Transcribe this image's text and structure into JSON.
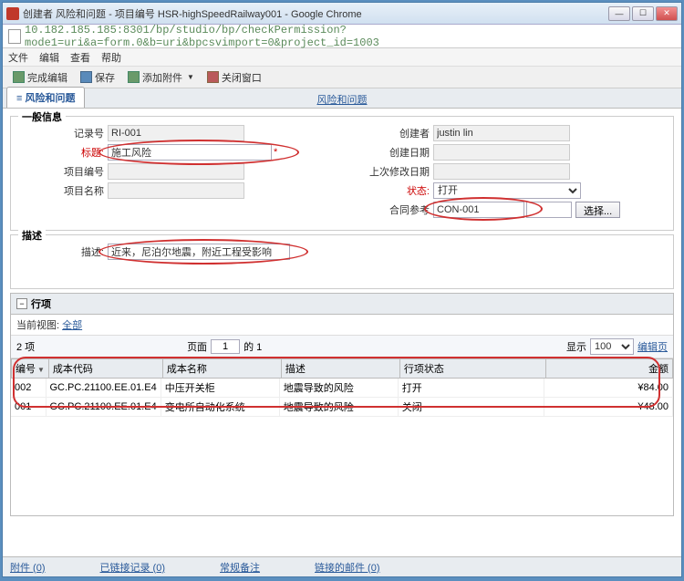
{
  "window": {
    "title": "创建者 风险和问题 - 项目编号 HSR-highSpeedRailway001 - Google Chrome",
    "url": "10.182.185.185:8301/bp/studio/bp/checkPermission?mode1=uri&a=form.0&b=uri&bpcsvimport=0&project_id=1003"
  },
  "menu": {
    "file": "文件",
    "edit": "编辑",
    "view": "查看",
    "help": "帮助"
  },
  "toolbar": {
    "finish": "完成编辑",
    "save": "保存",
    "attach": "添加附件",
    "close": "关闭窗口"
  },
  "tabs": {
    "main": "风险和问题",
    "center": "风险和问题"
  },
  "general": {
    "legend": "一般信息",
    "record_no_lbl": "记录号",
    "record_no": "RI-001",
    "title_lbl": "标题:",
    "title_val": "施工风险",
    "proj_no_lbl": "项目编号",
    "proj_no": "",
    "proj_name_lbl": "项目名称",
    "proj_name": "",
    "creator_lbl": "创建者",
    "creator": "justin lin",
    "create_date_lbl": "创建日期",
    "create_date": "",
    "mod_date_lbl": "上次修改日期",
    "mod_date": "",
    "status_lbl": "状态:",
    "status": "打开",
    "contract_lbl": "合同参考",
    "contract": "CON-001",
    "select_btn": "选择..."
  },
  "desc": {
    "legend": "描述",
    "lbl": "描述:",
    "value": "近来，尼泊尔地震，附近工程受影响"
  },
  "lineitems": {
    "legend": "行项",
    "view_prefix": "当前视图:",
    "view": "全部",
    "count": "2 项",
    "page_lbl": "页面",
    "page": "1",
    "of": "的 1",
    "show": "显示",
    "show_n": "100",
    "editpage": "编辑页",
    "cols": {
      "no": "编号",
      "code": "成本代码",
      "name": "成本名称",
      "desc": "描述",
      "status": "行项状态",
      "amount": "金额"
    },
    "rows": [
      {
        "no": "002",
        "code": "GC.PC.21100.EE.01.E4",
        "name": "中压开关柜",
        "desc": "地震导致的风险",
        "status": "打开",
        "amount": "¥84.00"
      },
      {
        "no": "001",
        "code": "GC.PC.21100.EE.01.E4",
        "name": "变电所自动化系统",
        "desc": "地震导致的风险",
        "status": "关闭",
        "amount": "¥48.00"
      }
    ]
  },
  "footer": {
    "attach": "附件 (0)",
    "linked": "已链接记录 (0)",
    "notes": "常规备注",
    "mail": "链接的邮件 (0)"
  }
}
